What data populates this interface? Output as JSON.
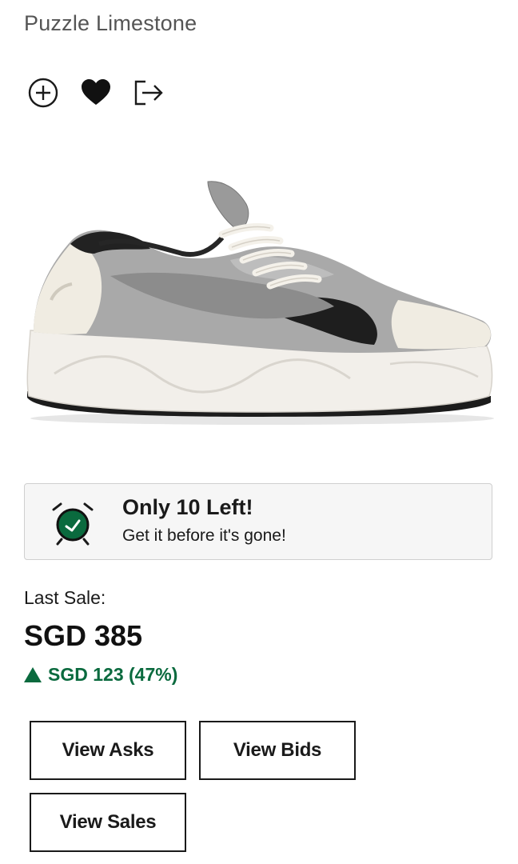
{
  "product": {
    "subtitle": "Puzzle Limestone"
  },
  "actions": {
    "icons": [
      "plus-circle-icon",
      "heart-icon",
      "share-icon"
    ]
  },
  "urgency": {
    "title": "Only 10 Left!",
    "subtitle": "Get it before it's gone!",
    "icon": "alarm-clock-icon",
    "icon_color": "#0a6a3e"
  },
  "last_sale": {
    "label": "Last Sale:",
    "price": "SGD 385",
    "change": "SGD 123 (47%)",
    "change_direction": "up",
    "change_color": "#0a6a3e"
  },
  "buttons": {
    "view_asks": "View Asks",
    "view_bids": "View Bids",
    "view_sales": "View Sales"
  }
}
